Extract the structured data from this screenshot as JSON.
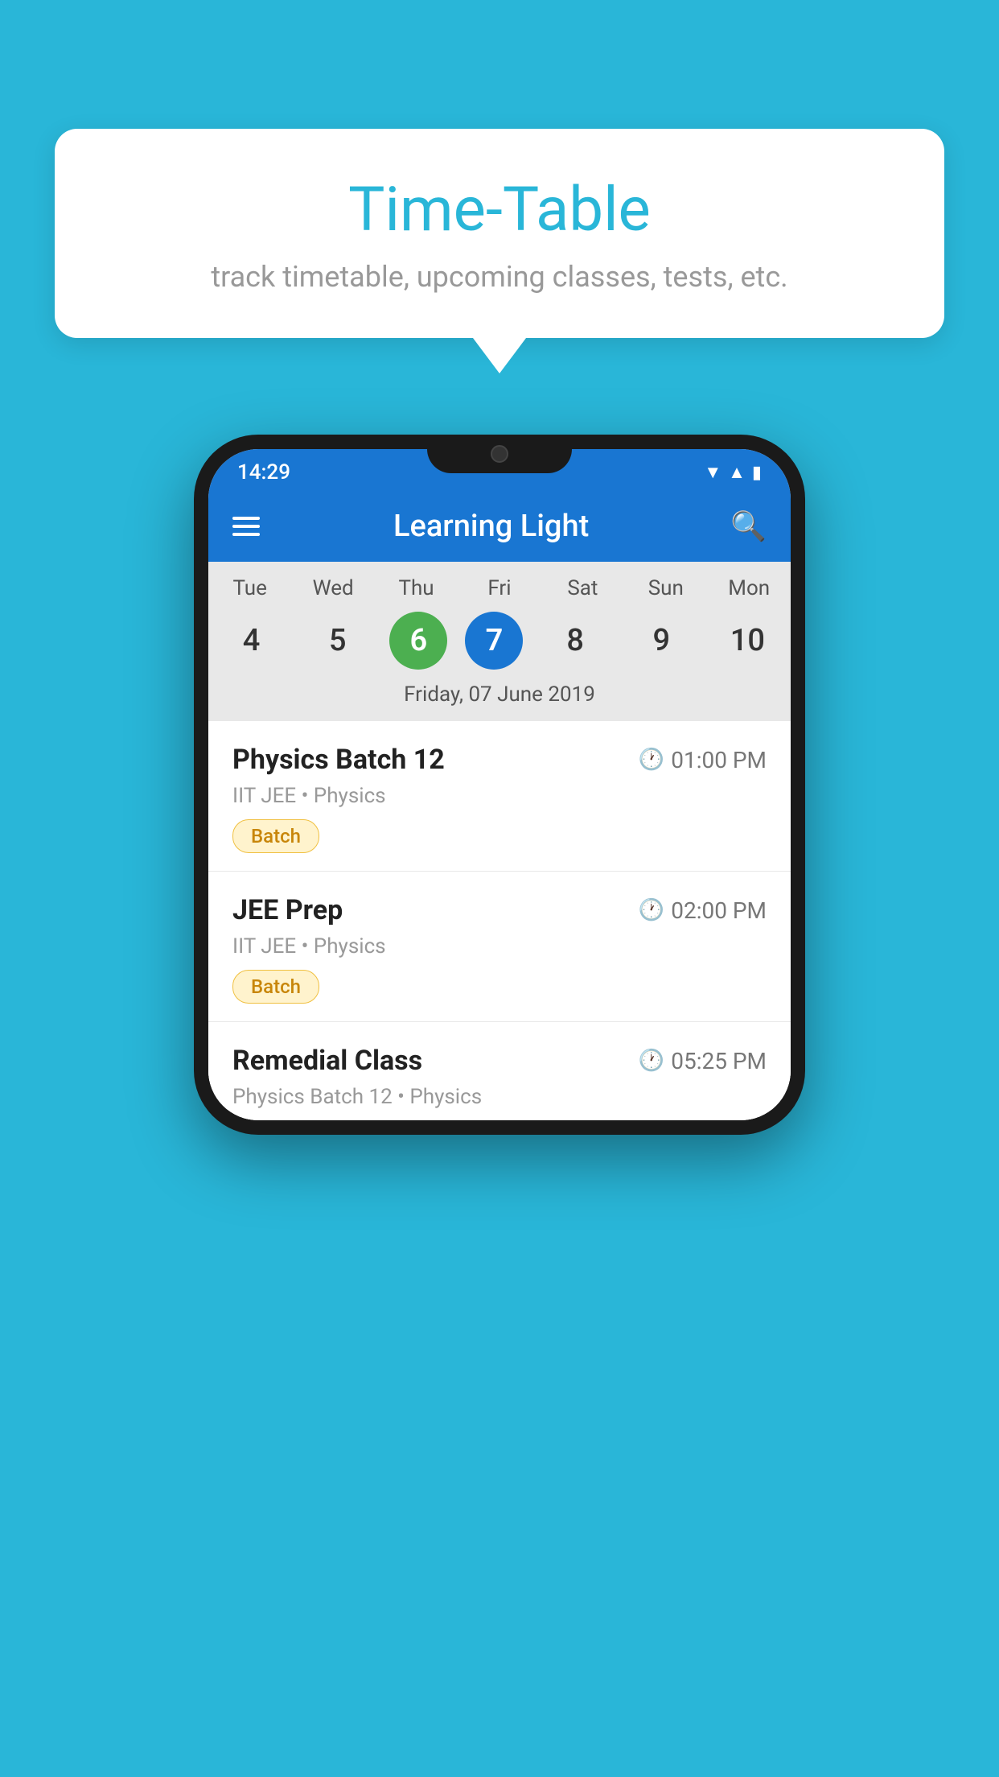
{
  "page": {
    "background_color": "#29b6d8"
  },
  "tooltip": {
    "title": "Time-Table",
    "subtitle": "track timetable, upcoming classes, tests, etc."
  },
  "status_bar": {
    "time": "14:29"
  },
  "app_bar": {
    "title": "Learning Light",
    "menu_icon": "hamburger-icon",
    "search_icon": "search-icon"
  },
  "calendar": {
    "days": [
      {
        "label": "Tue",
        "num": "4"
      },
      {
        "label": "Wed",
        "num": "5"
      },
      {
        "label": "Thu",
        "num": "6",
        "state": "today"
      },
      {
        "label": "Fri",
        "num": "7",
        "state": "selected"
      },
      {
        "label": "Sat",
        "num": "8"
      },
      {
        "label": "Sun",
        "num": "9"
      },
      {
        "label": "Mon",
        "num": "10"
      }
    ],
    "selected_date": "Friday, 07 June 2019"
  },
  "schedule": [
    {
      "title": "Physics Batch 12",
      "time": "01:00 PM",
      "subtitle": "IIT JEE • Physics",
      "tag": "Batch"
    },
    {
      "title": "JEE Prep",
      "time": "02:00 PM",
      "subtitle": "IIT JEE • Physics",
      "tag": "Batch"
    },
    {
      "title": "Remedial Class",
      "time": "05:25 PM",
      "subtitle": "Physics Batch 12 • Physics",
      "tag": null
    }
  ]
}
